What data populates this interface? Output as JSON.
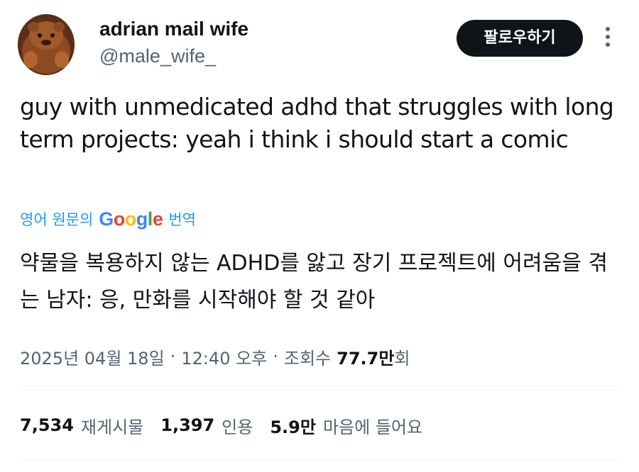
{
  "author": {
    "display_name": "adrian mail wife",
    "handle": "@male_wife_",
    "avatar_icon": "avatar-photo"
  },
  "follow_button": {
    "label": "팔로우하기"
  },
  "more_menu": {
    "icon": "more-vertical-icon"
  },
  "tweet": {
    "text": "guy with unmedicated adhd that struggles with long term projects: yeah i think i should start a comic"
  },
  "translation": {
    "link_label": "영어 원문의",
    "google_word": "Google",
    "translate_label": "번역",
    "text": "약물을 복용하지 않는 ADHD를 앓고 장기 프로젝트에 어려움을 겪는 남자: 응, 만화를 시작해야 할 것 같아"
  },
  "meta": {
    "date": "2025년 04월 18일",
    "separator": "·",
    "time": "12:40 오후",
    "views_label": "조회수",
    "views_count": "77.7만",
    "views_suffix": "회"
  },
  "stats": {
    "reposts_count": "7,534",
    "reposts_label": "재게시물",
    "quotes_count": "1,397",
    "quotes_label": "인용",
    "likes_count": "5.9만",
    "likes_label": "마음에 들어요"
  },
  "colors": {
    "text": "#0f1419",
    "secondary": "#536471",
    "link": "#1d9bf0",
    "button_bg": "#0f1419"
  }
}
